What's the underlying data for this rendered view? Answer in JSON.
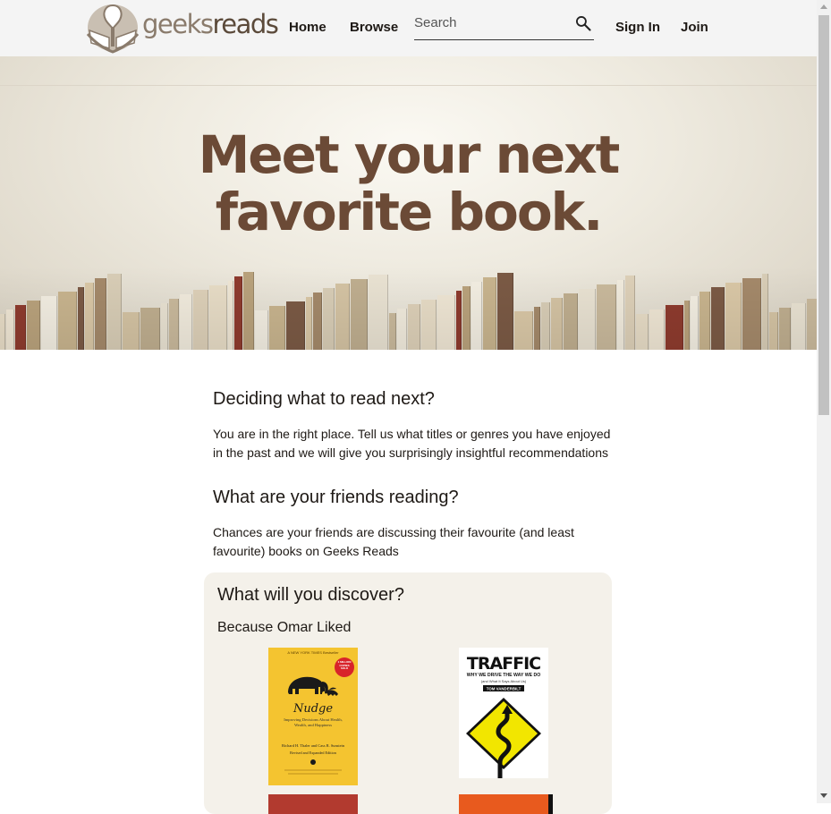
{
  "header": {
    "logo_light": "geeks",
    "logo_dark": "reads",
    "nav": {
      "home": "Home",
      "browse": "Browse",
      "sign_in": "Sign In",
      "join": "Join"
    },
    "search": {
      "placeholder": "Search"
    }
  },
  "hero": {
    "line1": "Meet your next",
    "line2": "favorite book."
  },
  "sections": [
    {
      "title": "Deciding what to read next?",
      "body": "You are in the right place. Tell us what titles or genres you have enjoyed in the past and we will give you surprisingly insightful recommendations"
    },
    {
      "title": "What are your friends reading?",
      "body": "Chances are your friends are discussing their favourite (and least favourite) books on Geeks Reads"
    }
  ],
  "discover": {
    "title": "What will you discover?",
    "subtitle": "Because Omar Liked",
    "books": [
      {
        "title": "Nudge",
        "banner": "A NEW YORK TIMES Bestseller",
        "badge": "1 MILLION COPIES SOLD",
        "subtitle": "Improving Decisions About Health, Wealth, and Happiness",
        "authors": "Richard H. Thaler and Cass R. Sunstein",
        "edition": "Revised and Expanded Edition",
        "cover_color": "#f4c430"
      },
      {
        "title": "TRAFFIC",
        "subtitle": "WHY WE DRIVE THE WAY WE DO",
        "tagline": "(and What It Says About Us)",
        "author": "TOM VANDERBILT",
        "cover_color": "#ffffff"
      }
    ]
  },
  "colors": {
    "header_bg": "#f4f4f4",
    "hero_title": "#6b4a36",
    "discover_bg": "#f4f1ea"
  }
}
